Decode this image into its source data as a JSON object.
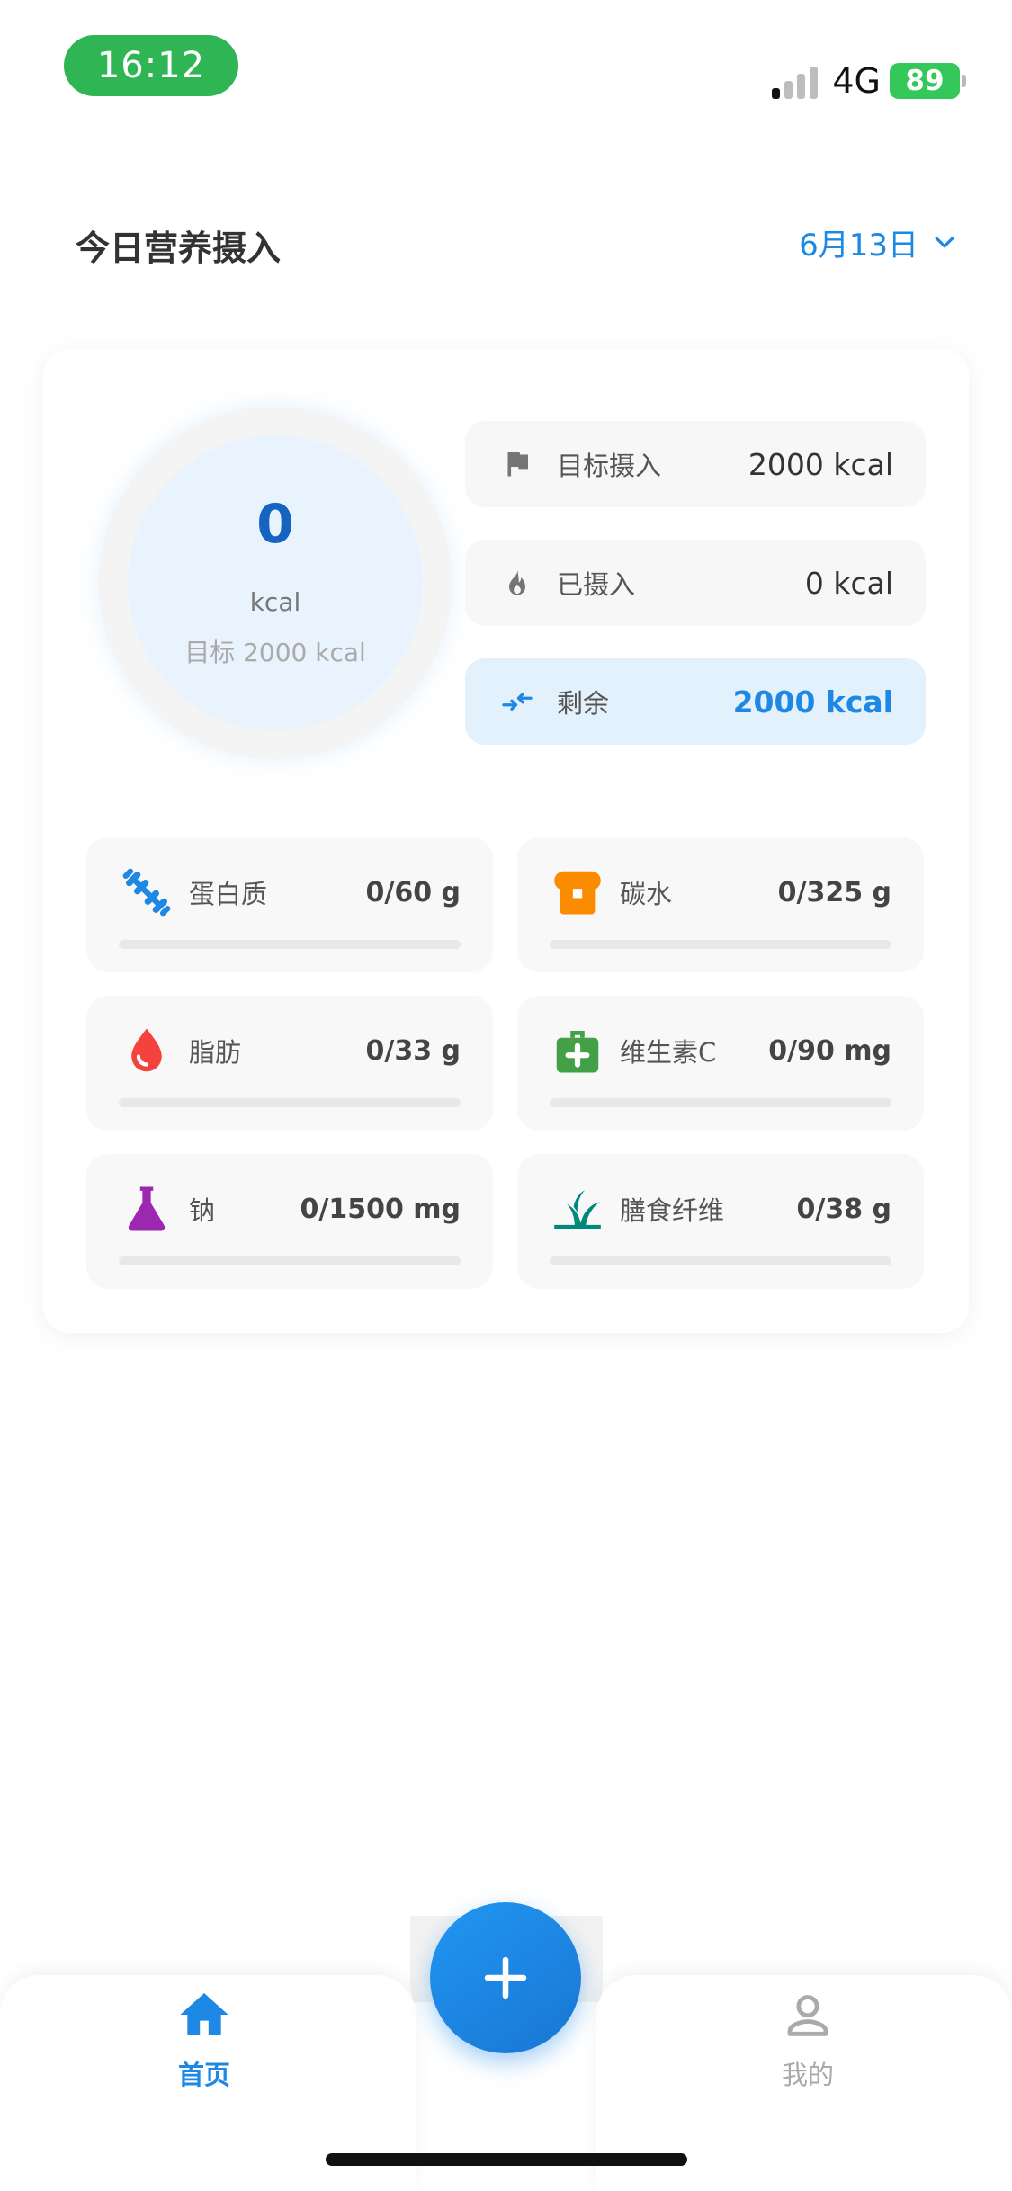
{
  "status_bar": {
    "time": "16:12",
    "network": "4G",
    "battery": "89"
  },
  "header": {
    "title": "今日营养摄入",
    "date": "6月13日"
  },
  "calorie_ring": {
    "value": "0",
    "unit": "kcal",
    "target_text": "目标 2000 kcal"
  },
  "stats": [
    {
      "label": "目标摄入",
      "value": "2000 kcal",
      "icon": "flag-icon"
    },
    {
      "label": "已摄入",
      "value": "0 kcal",
      "icon": "fire-icon"
    },
    {
      "label": "剩余",
      "value": "2000 kcal",
      "icon": "compare-arrows-icon"
    }
  ],
  "nutrients": [
    {
      "label": "蛋白质",
      "value": "0/60 g",
      "icon": "dumbbell-icon",
      "color": "#1e88e5",
      "progress": 0
    },
    {
      "label": "碳水",
      "value": "0/325 g",
      "icon": "bread-icon",
      "color": "#fb8c00",
      "progress": 0
    },
    {
      "label": "脂肪",
      "value": "0/33 g",
      "icon": "drop-icon",
      "color": "#f4433c",
      "progress": 0
    },
    {
      "label": "维生素C",
      "value": "0/90 mg",
      "icon": "medkit-icon",
      "color": "#43a047",
      "progress": 0
    },
    {
      "label": "钠",
      "value": "0/1500 mg",
      "icon": "flask-icon",
      "color": "#9c27b0",
      "progress": 0
    },
    {
      "label": "膳食纤维",
      "value": "0/38 g",
      "icon": "grass-icon",
      "color": "#00897b",
      "progress": 0
    }
  ],
  "tabbar": {
    "home_label": "首页",
    "mine_label": "我的",
    "active_color": "#1e88e5",
    "inactive_color": "#aaaaaa"
  }
}
